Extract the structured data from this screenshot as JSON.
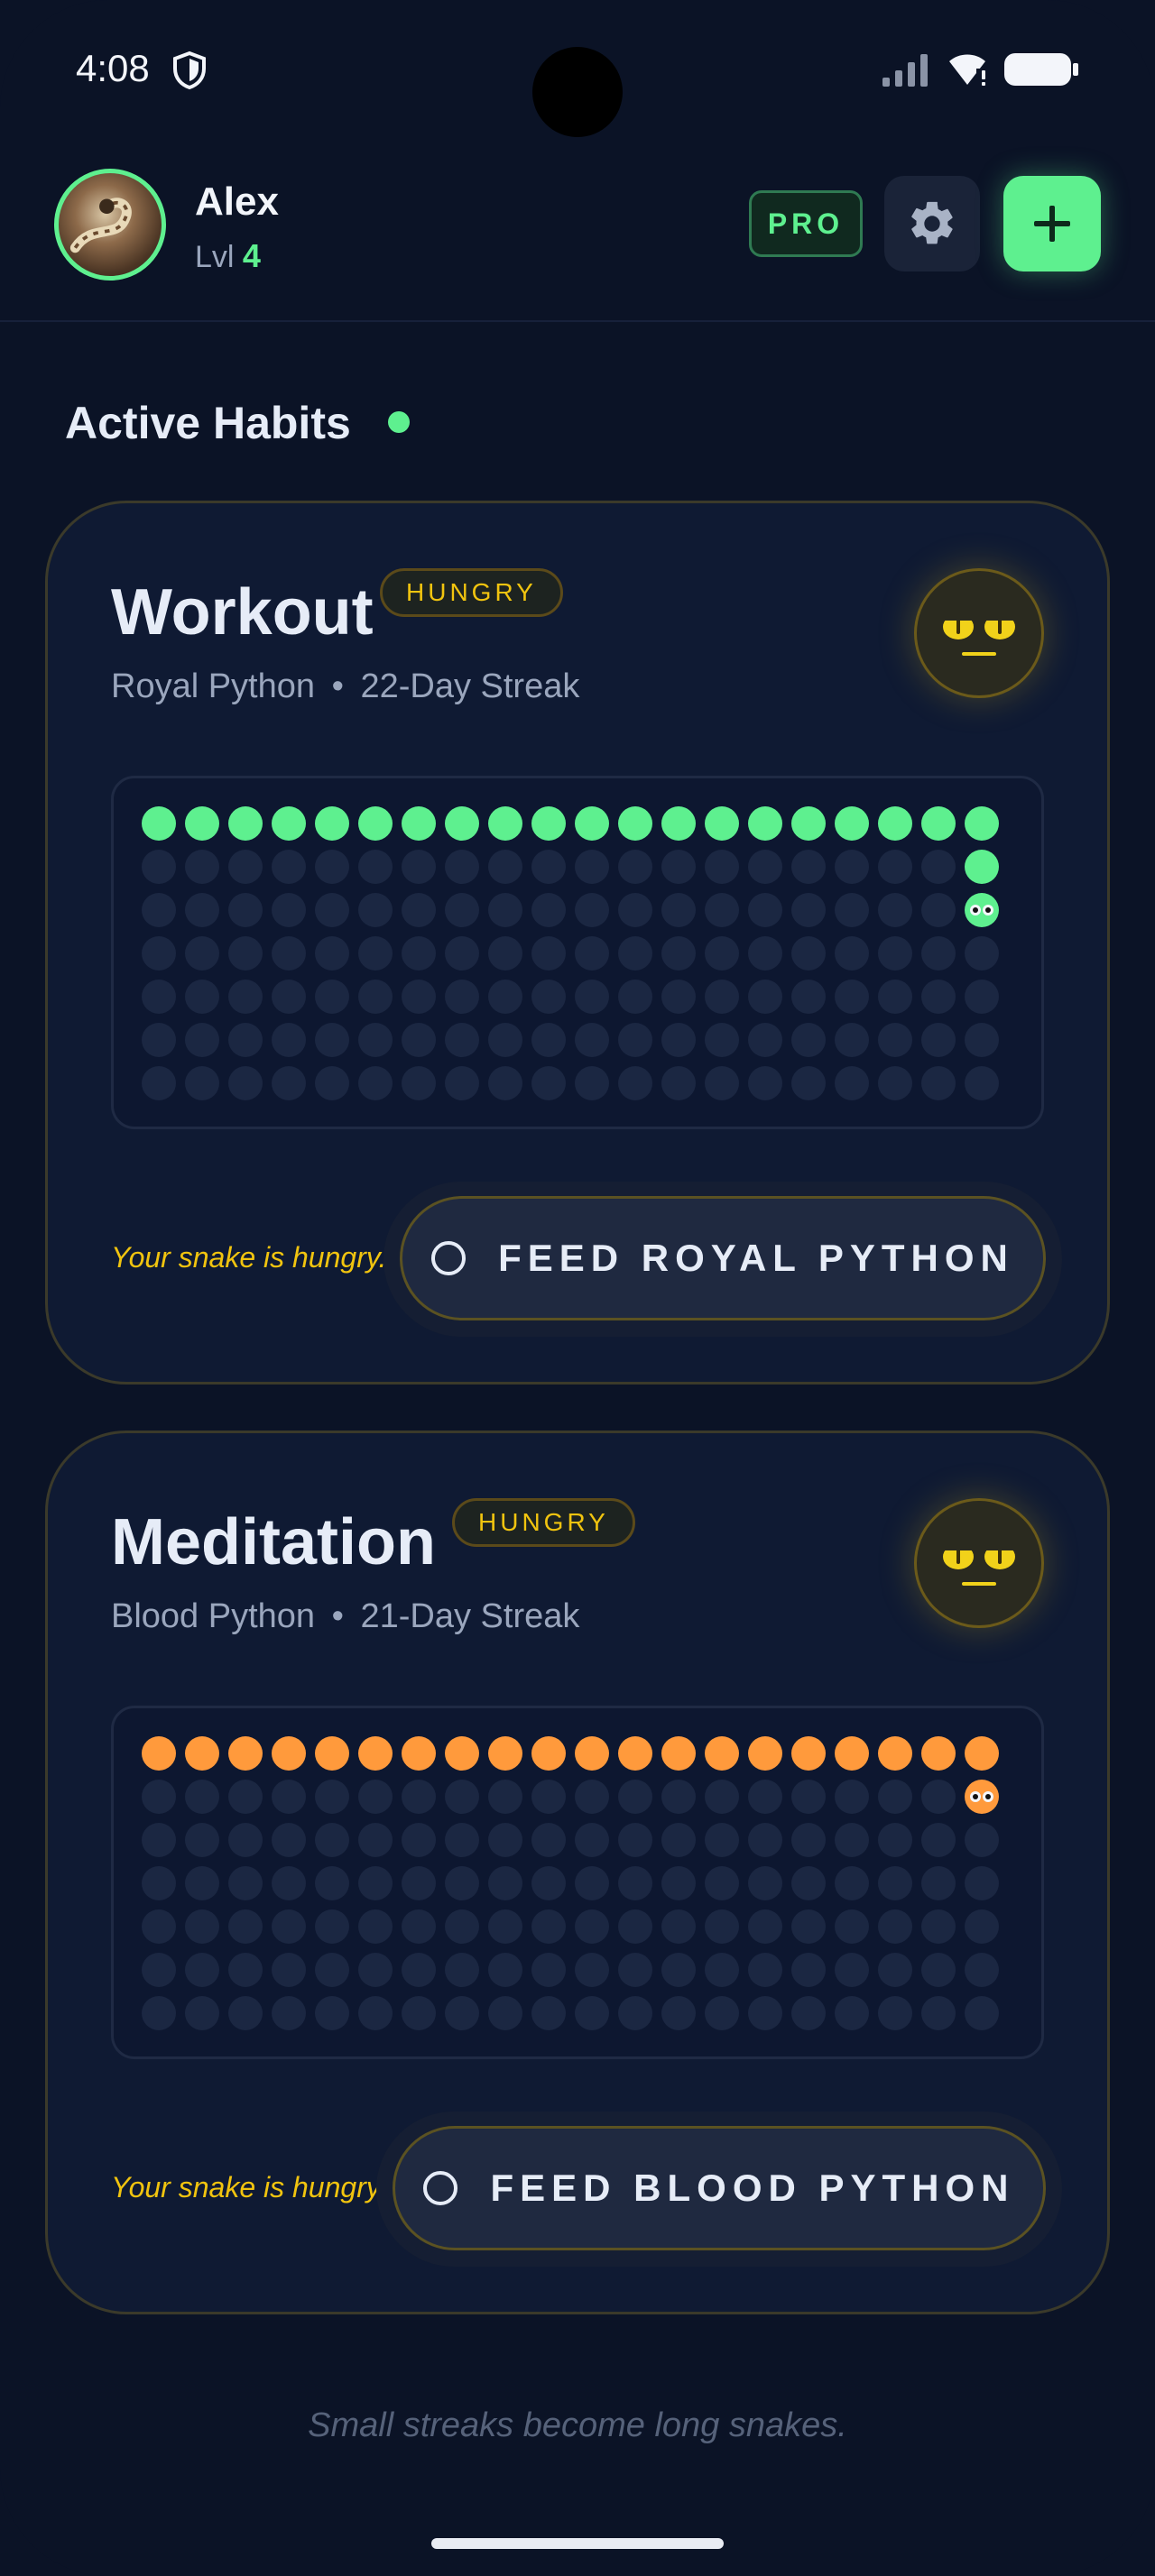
{
  "status": {
    "time": "4:08"
  },
  "header": {
    "username": "Alex",
    "level_label": "Lvl",
    "level_value": "4",
    "pro_badge": "PRO"
  },
  "section": {
    "title": "Active Habits"
  },
  "habits": [
    {
      "title": "Workout",
      "status_badge": "HUNGRY",
      "species": "Royal Python",
      "separator": "•",
      "streak": "22-Day Streak",
      "streak_days": 22,
      "snake_color": "#5ef08f",
      "hint": "Your snake is hungry.",
      "feed_label": "FEED ROYAL PYTHON"
    },
    {
      "title": "Meditation",
      "status_badge": "HUNGRY",
      "species": "Blood Python",
      "separator": "•",
      "streak": "21-Day Streak",
      "streak_days": 21,
      "snake_color": "#ff9a3c",
      "hint": "Your snake is hungry.",
      "feed_label": "FEED BLOOD PYTHON"
    }
  ],
  "footer": {
    "quote": "Small streaks become long snakes."
  },
  "colors": {
    "accent": "#5ef08f",
    "warning": "#f1c40f",
    "background": "#0b1326"
  },
  "icons": [
    "shield-icon",
    "signal-icon",
    "wifi-icon",
    "battery-icon",
    "gear-icon",
    "plus-icon",
    "snake-face-icon",
    "radio-circle-icon"
  ]
}
